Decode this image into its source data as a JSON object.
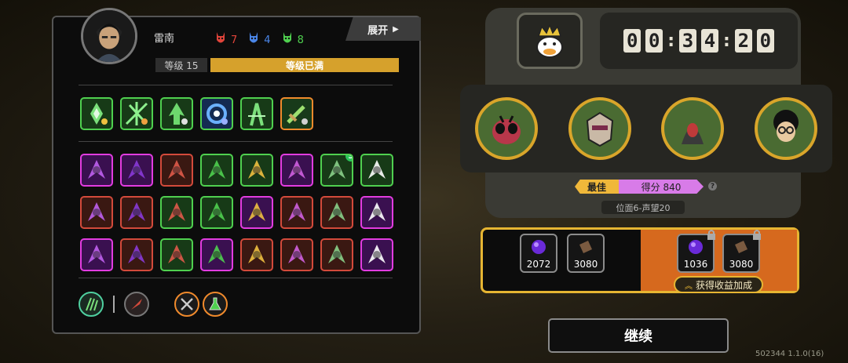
{
  "player": {
    "name": "雷南",
    "level_label": "等级 15",
    "level_status": "等级已满",
    "expand_label": "展开"
  },
  "resources": [
    {
      "icon": "red-demon-mask-icon",
      "value": "7",
      "color": "#e2443a"
    },
    {
      "icon": "blue-demon-mask-icon",
      "value": "4",
      "color": "#4a86e8"
    },
    {
      "icon": "green-demon-mask-icon",
      "value": "8",
      "color": "#4fd04f"
    }
  ],
  "weapon_skills": [
    {
      "icon": "green-diamond-skill-icon"
    },
    {
      "icon": "green-burst-skill-icon"
    },
    {
      "icon": "green-arrow-skill-icon"
    },
    {
      "icon": "blue-vortex-skill-icon"
    },
    {
      "icon": "green-split-skill-icon"
    },
    {
      "icon": "green-sword-skill-icon"
    }
  ],
  "passive_grid": [
    {
      "icon": "purple-drip-icon",
      "style": "pink"
    },
    {
      "icon": "purple-crescent-icon",
      "style": "pink"
    },
    {
      "icon": "shield-face-icon",
      "style": "red"
    },
    {
      "icon": "green-leaf-burst-icon",
      "style": "green"
    },
    {
      "icon": "gold-arrow-icon",
      "style": "green"
    },
    {
      "icon": "purple-blade-icon",
      "style": "pink"
    },
    {
      "icon": "bullet-belt-icon",
      "style": "green",
      "badge": "3"
    },
    {
      "icon": "cracked-orb-icon",
      "style": "green"
    },
    {
      "icon": "compass-wheel-icon",
      "style": "red"
    },
    {
      "icon": "crossed-daggers-icon",
      "style": "red"
    },
    {
      "icon": "triple-arrow-icon",
      "style": "green"
    },
    {
      "icon": "red-arrow-icon",
      "style": "green"
    },
    {
      "icon": "purple-cross-icon",
      "style": "pink"
    },
    {
      "icon": "green-slash-icon",
      "style": "red"
    },
    {
      "icon": "purple-feather-icon",
      "style": "red"
    },
    {
      "icon": "purple-ghost-icon",
      "style": "pink"
    },
    {
      "icon": "pink-sparkle-icon",
      "style": "pink"
    },
    {
      "icon": "red-hand-icon",
      "style": "red"
    },
    {
      "icon": "red-swirl-icon",
      "style": "green"
    },
    {
      "icon": "purple-lance-icon",
      "style": "pink"
    },
    {
      "icon": "golden-gate-icon",
      "style": "red"
    },
    {
      "icon": "teal-shuriken-icon",
      "style": "red"
    },
    {
      "icon": "pink-monster-face-icon",
      "style": "red"
    },
    {
      "icon": "pink-monster-face-icon",
      "style": "pink"
    }
  ],
  "equipment": [
    {
      "icon": "green-claw-icon"
    },
    {
      "icon": "red-blade-icon"
    },
    {
      "icon": "crossed-swords-icon"
    },
    {
      "icon": "potion-flask-icon"
    }
  ],
  "timer": {
    "digits": [
      "0",
      "0",
      "3",
      "4",
      "2",
      "0"
    ]
  },
  "crown_icon": "crowned-duck-icon",
  "portraits": [
    {
      "icon": "insect-monster-portrait-icon",
      "bg": "#4a6b32"
    },
    {
      "icon": "robot-mask-portrait-icon",
      "bg": "#4a6b32"
    },
    {
      "icon": "hooded-figure-portrait-icon",
      "bg": "#4a6b32"
    },
    {
      "icon": "curly-hair-portrait-icon",
      "bg": "#4a6b32"
    }
  ],
  "score": {
    "best_label": "最佳",
    "score_text": "得分 840",
    "help": "?",
    "rank_text": "位面6-声望20"
  },
  "rewards": [
    {
      "icon": "purple-gem-icon",
      "value": "2072",
      "locked": false
    },
    {
      "icon": "brown-block-icon",
      "value": "3080",
      "locked": false
    },
    {
      "icon": "purple-gem-icon",
      "value": "1036",
      "locked": true
    },
    {
      "icon": "brown-block-icon",
      "value": "3080",
      "locked": true
    }
  ],
  "bonus_label": "获得收益加成",
  "continue_label": "继续",
  "version": "502344 1.1.0(16)"
}
